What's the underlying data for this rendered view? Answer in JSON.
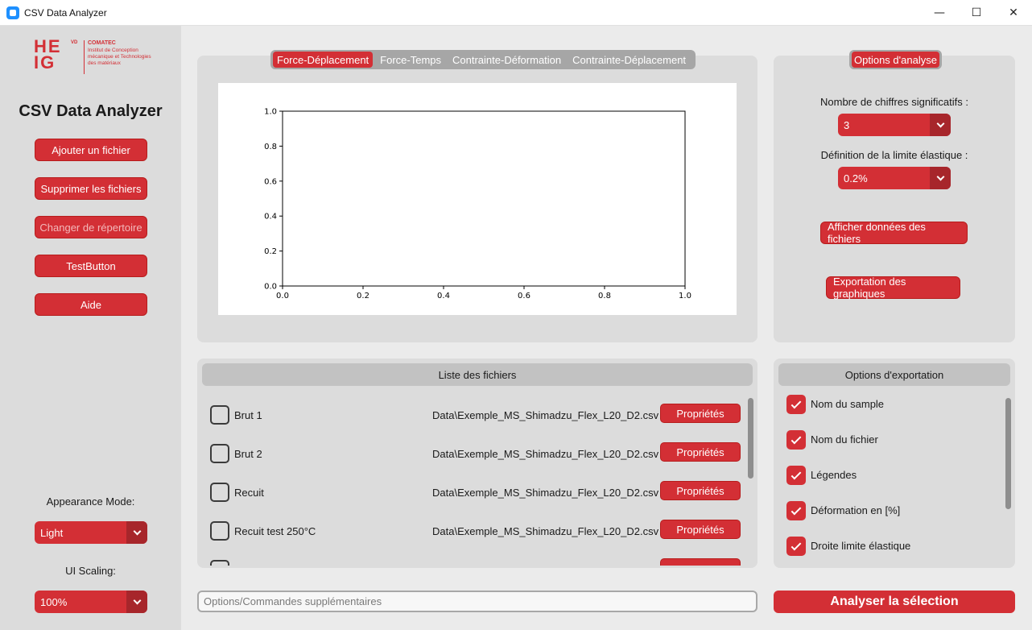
{
  "window": {
    "title": "CSV Data Analyzer",
    "minimize": "—",
    "maximize": "☐",
    "close": "✕"
  },
  "sidebar": {
    "logo": {
      "heig": "HE\nIG",
      "vd": "VD",
      "comatec": "COMATEC",
      "description": "Institut de Conception mécanique et Technologies des matériaux"
    },
    "title": "CSV Data Analyzer",
    "buttons": [
      {
        "label": "Ajouter un fichier"
      },
      {
        "label": "Supprimer les fichiers"
      },
      {
        "label": "Changer de répertoire"
      },
      {
        "label": "TestButton"
      },
      {
        "label": "Aide"
      }
    ],
    "appearance_label": "Appearance Mode:",
    "appearance_value": "Light",
    "scaling_label": "UI Scaling:",
    "scaling_value": "100%"
  },
  "plot_tabs": [
    "Force-Déplacement",
    "Force-Temps",
    "Contrainte-Déformation",
    "Contrainte-Déplacement"
  ],
  "chart_data": {
    "type": "line",
    "series": [],
    "xlim": [
      0.0,
      1.0
    ],
    "ylim": [
      0.0,
      1.0
    ],
    "xticks": [
      "0.0",
      "0.2",
      "0.4",
      "0.6",
      "0.8",
      "1.0"
    ],
    "yticks": [
      "0.0",
      "0.2",
      "0.4",
      "0.6",
      "0.8",
      "1.0"
    ],
    "grid": false
  },
  "analysis": {
    "tab_label": "Options d'analyse",
    "sig_figs_label": "Nombre de chiffres significatifs :",
    "sig_figs_value": "3",
    "elastic_label": "Définition de la limite élastique :",
    "elastic_value": "0.2%",
    "show_data_button": "Afficher données des fichiers",
    "export_graphs_button": "Exportation des graphiques"
  },
  "file_list": {
    "header": "Liste des fichiers",
    "property_label": "Propriétés",
    "files": [
      {
        "name": "Brut 1",
        "path": "Data\\Exemple_MS_Shimadzu_Flex_L20_D2.csv"
      },
      {
        "name": "Brut 2",
        "path": "Data\\Exemple_MS_Shimadzu_Flex_L20_D2.csv"
      },
      {
        "name": "Recuit",
        "path": "Data\\Exemple_MS_Shimadzu_Flex_L20_D2.csv"
      },
      {
        "name": "Recuit test 250°C",
        "path": "Data\\Exemple_MS_Shimadzu_Flex_L20_D2.csv"
      }
    ]
  },
  "export_options": {
    "header": "Options d'exportation",
    "items": [
      {
        "label": "Nom du sample",
        "checked": true
      },
      {
        "label": "Nom du fichier",
        "checked": true
      },
      {
        "label": "Légendes",
        "checked": true
      },
      {
        "label": "Déformation en [%]",
        "checked": true
      },
      {
        "label": "Droite limite élastique",
        "checked": true
      }
    ]
  },
  "command": {
    "placeholder": "Options/Commandes supplémentaires"
  },
  "analyze_button": "Analyser la sélection"
}
